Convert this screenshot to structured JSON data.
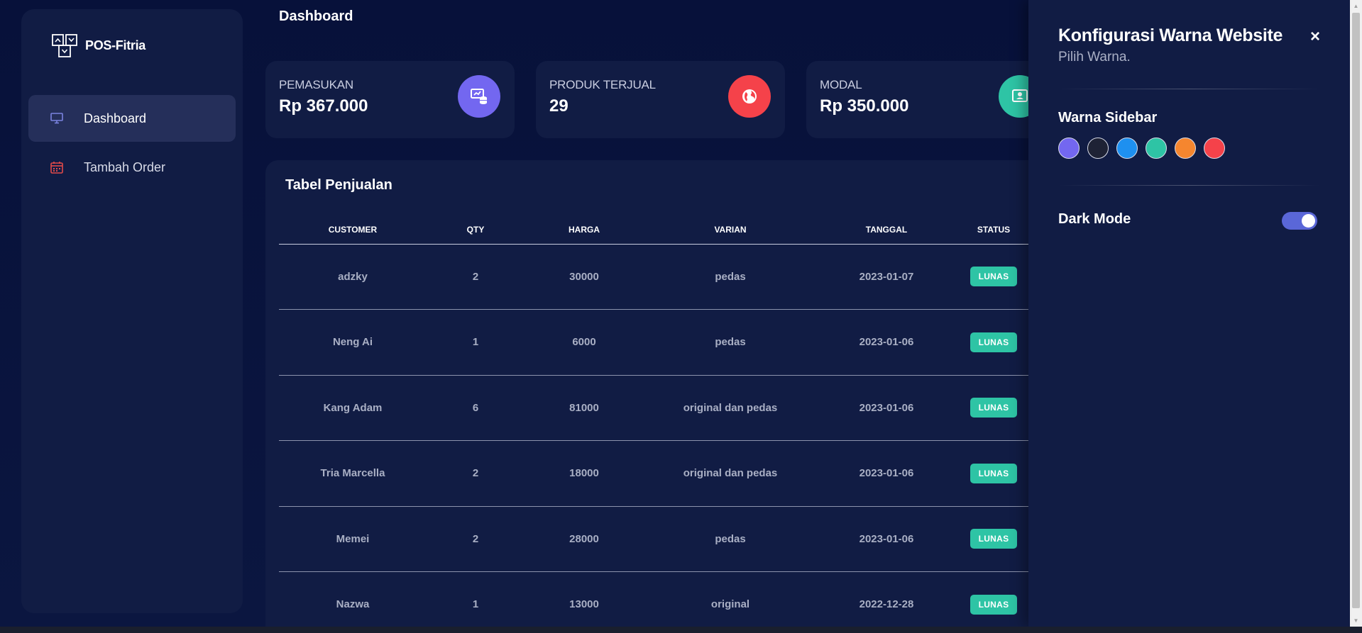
{
  "brand": {
    "name": "POS-Fitria",
    "icon": "pos-logo-icon"
  },
  "sidebar": {
    "items": [
      {
        "label": "Dashboard",
        "icon": "monitor-icon",
        "active": true,
        "icon_color": "#7b83e0"
      },
      {
        "label": "Tambah Order",
        "icon": "calendar-icon",
        "active": false,
        "icon_color": "#e24a4a"
      }
    ]
  },
  "header": {
    "title": "Dashboard"
  },
  "stats": [
    {
      "label": "PEMASUKAN",
      "value": "Rp 367.000",
      "icon": "database-screen-icon",
      "color": "#7367f0"
    },
    {
      "label": "PRODUK TERJUAL",
      "value": "29",
      "icon": "globe-icon",
      "color": "#f5424a"
    },
    {
      "label": "MODAL",
      "value": "Rp 350.000",
      "icon": "user-card-icon",
      "color": "#2ec4a5"
    }
  ],
  "table": {
    "title": "Tabel Penjualan",
    "columns": [
      "CUSTOMER",
      "QTY",
      "HARGA",
      "VARIAN",
      "TANGGAL",
      "STATUS"
    ],
    "rows": [
      {
        "customer": "adzky",
        "qty": "2",
        "harga": "30000",
        "varian": "pedas",
        "tanggal": "2023-01-07",
        "status": "LUNAS"
      },
      {
        "customer": "Neng Ai",
        "qty": "1",
        "harga": "6000",
        "varian": "pedas",
        "tanggal": "2023-01-06",
        "status": "LUNAS"
      },
      {
        "customer": "Kang Adam",
        "qty": "6",
        "harga": "81000",
        "varian": "original dan pedas",
        "tanggal": "2023-01-06",
        "status": "LUNAS"
      },
      {
        "customer": "Tria Marcella",
        "qty": "2",
        "harga": "18000",
        "varian": "original dan pedas",
        "tanggal": "2023-01-06",
        "status": "LUNAS"
      },
      {
        "customer": "Memei",
        "qty": "2",
        "harga": "28000",
        "varian": "pedas",
        "tanggal": "2023-01-06",
        "status": "LUNAS"
      },
      {
        "customer": "Nazwa",
        "qty": "1",
        "harga": "13000",
        "varian": "original",
        "tanggal": "2022-12-28",
        "status": "LUNAS"
      }
    ]
  },
  "config": {
    "title": "Konfigurasi Warna Website",
    "subtitle": "Pilih Warna.",
    "close_icon": "close-icon",
    "close_glyph": "×",
    "sidebar_color_label": "Warna Sidebar",
    "swatches": [
      "#7367f0",
      "#1e2235",
      "#1e90f0",
      "#2ec4a5",
      "#f5862f",
      "#f5424a"
    ],
    "dark_mode_label": "Dark Mode",
    "dark_mode_on": true
  },
  "colors": {
    "accent": "#5a67d8",
    "status_badge": "#2ec4a5",
    "panel": "#111c44",
    "background": "#081236"
  }
}
